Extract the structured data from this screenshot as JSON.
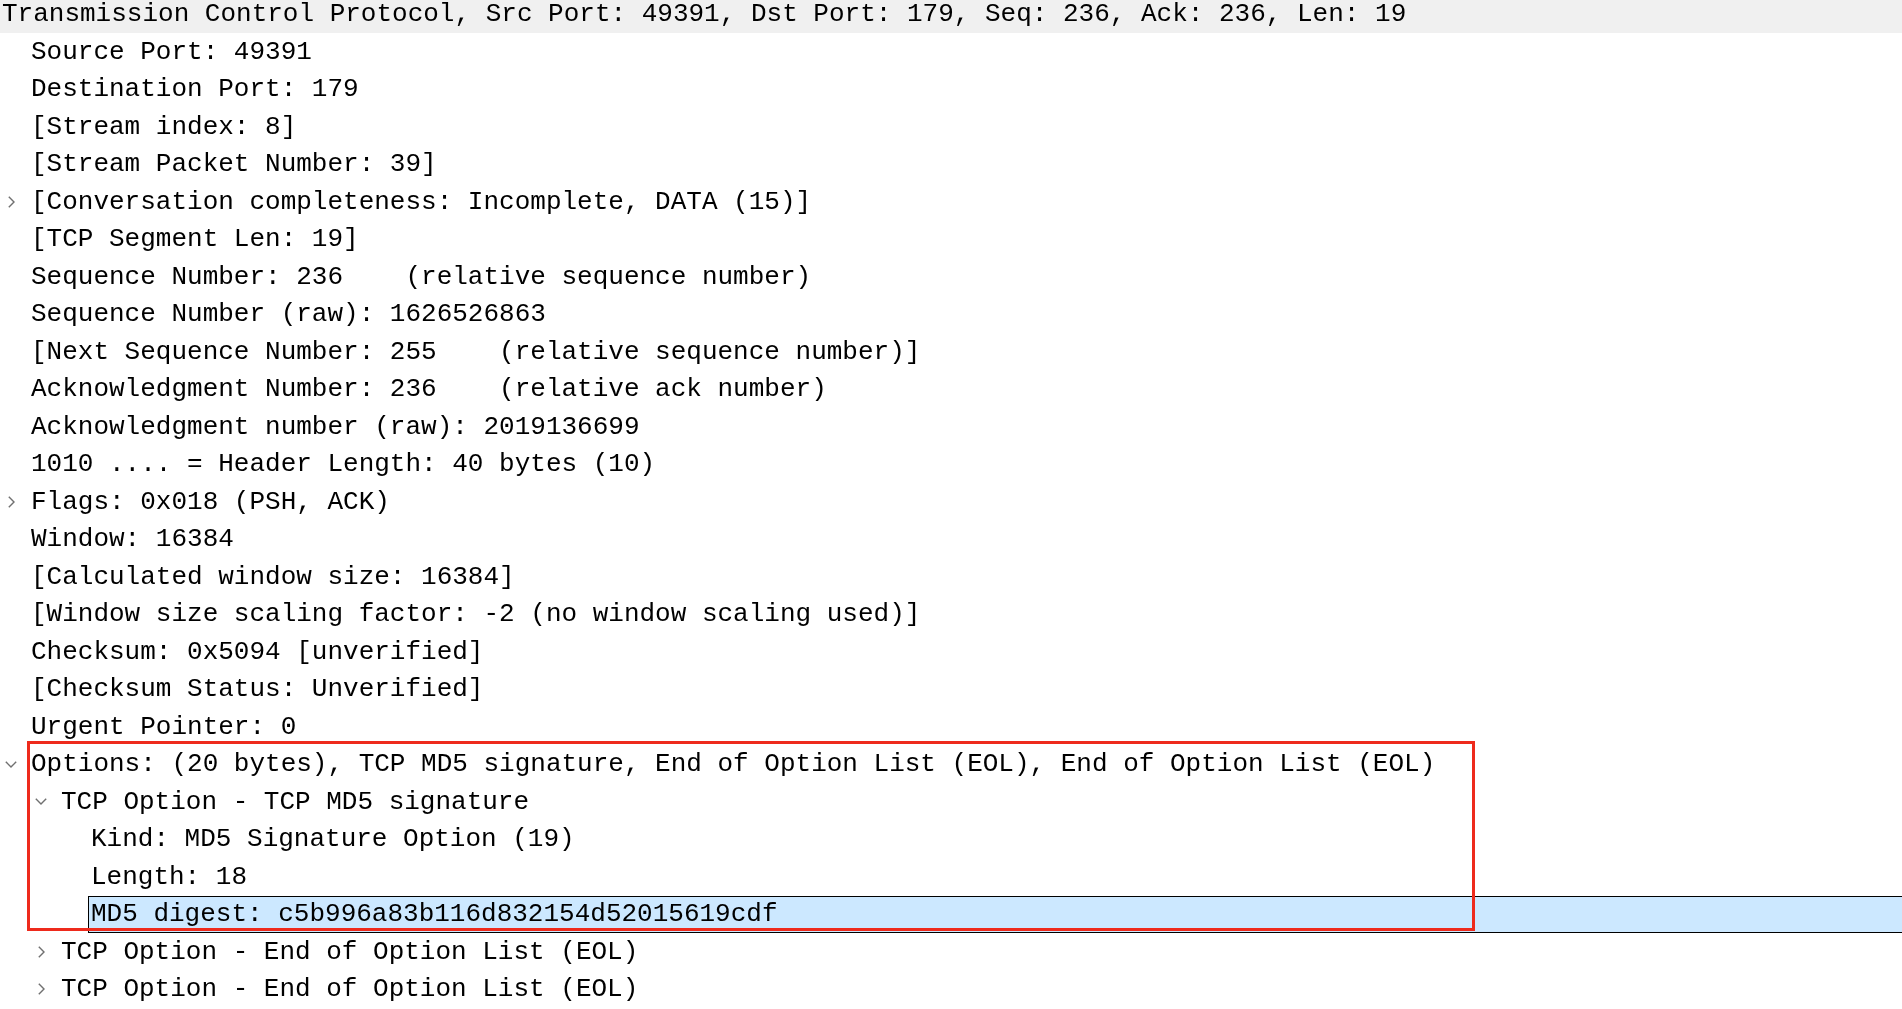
{
  "header": {
    "text": "Transmission Control Protocol, Src Port: 49391, Dst Port: 179, Seq: 236, Ack: 236, Len: 19"
  },
  "tree": [
    {
      "text": "Source Port: 49391",
      "kind": "leaf",
      "expanded": false,
      "selected": false,
      "outlined": false
    },
    {
      "text": "Destination Port: 179",
      "kind": "leaf",
      "expanded": false,
      "selected": false,
      "outlined": false
    },
    {
      "text": "[Stream index: 8]",
      "kind": "leaf",
      "expanded": false,
      "selected": false,
      "outlined": false
    },
    {
      "text": "[Stream Packet Number: 39]",
      "kind": "leaf",
      "expanded": false,
      "selected": false,
      "outlined": false
    },
    {
      "text": "[Conversation completeness: Incomplete, DATA (15)]",
      "kind": "branch",
      "expanded": false,
      "selected": false,
      "outlined": false
    },
    {
      "text": "[TCP Segment Len: 19]",
      "kind": "leaf",
      "expanded": false,
      "selected": false,
      "outlined": false
    },
    {
      "text": "Sequence Number: 236    (relative sequence number)",
      "kind": "leaf",
      "expanded": false,
      "selected": false,
      "outlined": false
    },
    {
      "text": "Sequence Number (raw): 1626526863",
      "kind": "leaf",
      "expanded": false,
      "selected": false,
      "outlined": false
    },
    {
      "text": "[Next Sequence Number: 255    (relative sequence number)]",
      "kind": "leaf",
      "expanded": false,
      "selected": false,
      "outlined": false
    },
    {
      "text": "Acknowledgment Number: 236    (relative ack number)",
      "kind": "leaf",
      "expanded": false,
      "selected": false,
      "outlined": false
    },
    {
      "text": "Acknowledgment number (raw): 2019136699",
      "kind": "leaf",
      "expanded": false,
      "selected": false,
      "outlined": false
    },
    {
      "text": "1010 .... = Header Length: 40 bytes (10)",
      "kind": "leaf",
      "expanded": false,
      "selected": false,
      "outlined": false
    },
    {
      "text": "Flags: 0x018 (PSH, ACK)",
      "kind": "branch",
      "expanded": false,
      "selected": false,
      "outlined": false
    },
    {
      "text": "Window: 16384",
      "kind": "leaf",
      "expanded": false,
      "selected": false,
      "outlined": false
    },
    {
      "text": "[Calculated window size: 16384]",
      "kind": "leaf",
      "expanded": false,
      "selected": false,
      "outlined": false
    },
    {
      "text": "[Window size scaling factor: -2 (no window scaling used)]",
      "kind": "leaf",
      "expanded": false,
      "selected": false,
      "outlined": false
    },
    {
      "text": "Checksum: 0x5094 [unverified]",
      "kind": "leaf",
      "expanded": false,
      "selected": false,
      "outlined": false
    },
    {
      "text": "[Checksum Status: Unverified]",
      "kind": "leaf",
      "expanded": false,
      "selected": false,
      "outlined": false
    },
    {
      "text": "Urgent Pointer: 0",
      "kind": "leaf",
      "expanded": false,
      "selected": false,
      "outlined": false
    },
    {
      "text": "Options: (20 bytes), TCP MD5 signature, End of Option List (EOL), End of Option List (EOL)",
      "kind": "branch",
      "expanded": true,
      "selected": false,
      "outlined": true,
      "children": [
        {
          "text": "TCP Option - TCP MD5 signature",
          "kind": "branch",
          "expanded": true,
          "selected": false,
          "outlined": true,
          "children": [
            {
              "text": "Kind: MD5 Signature Option (19)",
              "kind": "leaf",
              "expanded": false,
              "selected": false,
              "outlined": true
            },
            {
              "text": "Length: 18",
              "kind": "leaf",
              "expanded": false,
              "selected": false,
              "outlined": true
            },
            {
              "text": "MD5 digest: c5b996a83b116d832154d52015619cdf",
              "kind": "leaf",
              "expanded": false,
              "selected": true,
              "outlined": true
            }
          ]
        },
        {
          "text": "TCP Option - End of Option List (EOL)",
          "kind": "branch",
          "expanded": false,
          "selected": false,
          "outlined": false
        },
        {
          "text": "TCP Option - End of Option List (EOL)",
          "kind": "branch",
          "expanded": false,
          "selected": false,
          "outlined": false
        }
      ]
    }
  ]
}
